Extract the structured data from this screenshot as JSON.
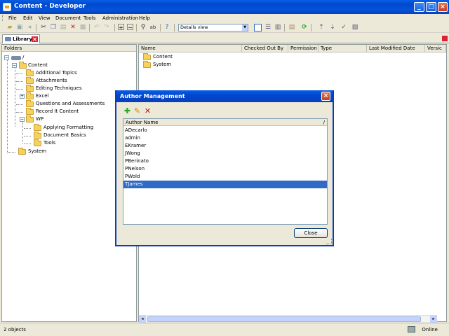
{
  "window": {
    "title": "Content - Developer"
  },
  "menu": [
    "File",
    "Edit",
    "View",
    "Document",
    "Tools",
    "Administration",
    "Help"
  ],
  "toolbar": {
    "buttons": [
      "open-icon",
      "save-icon",
      "undo-icon",
      "cut-icon",
      "copy-icon",
      "paste-icon",
      "delete-icon",
      "properties-icon",
      "undo-arrow-icon",
      "redo-arrow-icon",
      "expand-icon",
      "collapse-icon",
      "find-icon",
      "spell-check-icon",
      "help-icon"
    ],
    "view_select": "Details view",
    "right_buttons": [
      "details-view-icon",
      "list-view-icon",
      "columns-view-icon",
      "export-icon",
      "refresh-icon",
      "check-in-icon",
      "check-out-icon",
      "checked-out-icon"
    ]
  },
  "tab": {
    "label": "Library"
  },
  "folders": {
    "header": "Folders",
    "root": "/",
    "items": [
      {
        "label": "Content",
        "level": 1,
        "expanded": true
      },
      {
        "label": "Additional Topics",
        "level": 2
      },
      {
        "label": "Attachments",
        "level": 2
      },
      {
        "label": "Editing Techniques",
        "level": 2
      },
      {
        "label": "Excel",
        "level": 2,
        "expandable": true
      },
      {
        "label": "Questions and Assessments",
        "level": 2
      },
      {
        "label": "Record It Content",
        "level": 2
      },
      {
        "label": "WP",
        "level": 2,
        "expanded": true
      },
      {
        "label": "Applying Formatting",
        "level": 3
      },
      {
        "label": "Document Basics",
        "level": 3
      },
      {
        "label": "Tools",
        "level": 3
      },
      {
        "label": "System",
        "level": 1
      }
    ]
  },
  "documents": {
    "columns": [
      "Name",
      "Checked Out By",
      "Permission",
      "Type",
      "Last Modified Date",
      "Versic"
    ],
    "rows": [
      "Content",
      "System"
    ]
  },
  "dialog": {
    "title": "Author Management",
    "tools": [
      "add-icon",
      "edit-icon",
      "delete-icon"
    ],
    "column": "Author Name",
    "authors": [
      "ADecarlo",
      "admin",
      "EKramer",
      "JWong",
      "PBerinato",
      "PNelson",
      "PWold",
      "TJames"
    ],
    "selected": "TJames",
    "close_label": "Close"
  },
  "status": {
    "objects": "2 objects",
    "connection": "Online"
  }
}
